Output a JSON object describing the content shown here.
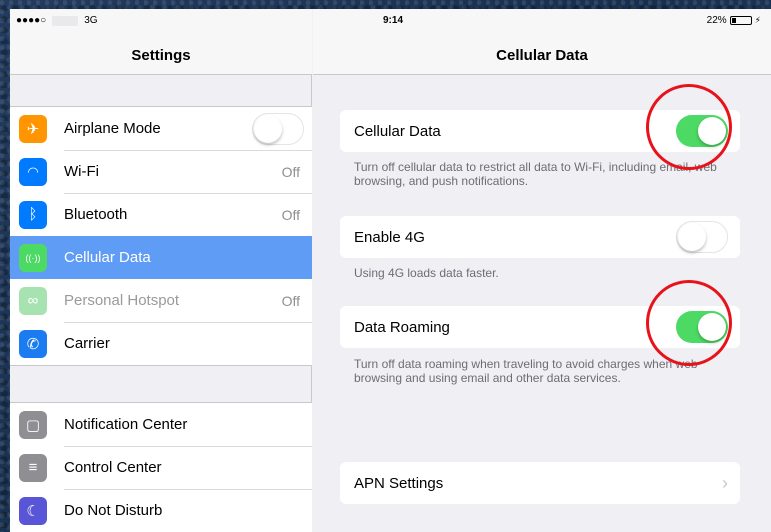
{
  "status": {
    "signal": "●●●●○",
    "network": "3G",
    "time": "9:14",
    "battery": "22%"
  },
  "left": {
    "title": "Settings",
    "group1": [
      {
        "label": "Airplane Mode",
        "icon": "airplane-icon",
        "icon_glyph": "✈",
        "color": "#ff9500",
        "control": "toggle-off"
      },
      {
        "label": "Wi-Fi",
        "icon": "wifi-icon",
        "icon_glyph": "◠",
        "color": "#007aff",
        "value": "Off"
      },
      {
        "label": "Bluetooth",
        "icon": "bluetooth-icon",
        "icon_glyph": "ᛒ",
        "color": "#007aff",
        "value": "Off"
      },
      {
        "label": "Cellular Data",
        "icon": "cellular-icon",
        "icon_glyph": "((·))",
        "color": "#4cd964",
        "selected": true
      },
      {
        "label": "Personal Hotspot",
        "icon": "hotspot-icon",
        "icon_glyph": "∞",
        "color": "#a6e3b0",
        "value": "Off",
        "dimmed": true
      },
      {
        "label": "Carrier",
        "icon": "phone-icon",
        "icon_glyph": "✆",
        "color": "#1a7cf0"
      }
    ],
    "group2": [
      {
        "label": "Notification Center",
        "icon": "notification-icon",
        "icon_glyph": "▢",
        "color": "#8e8e93"
      },
      {
        "label": "Control Center",
        "icon": "control-center-icon",
        "icon_glyph": "≡",
        "color": "#8e8e93"
      },
      {
        "label": "Do Not Disturb",
        "icon": "moon-icon",
        "icon_glyph": "☾",
        "color": "#5856d6"
      }
    ]
  },
  "right": {
    "title": "Cellular Data",
    "cellular_data": {
      "label": "Cellular Data",
      "on": true,
      "note": "Turn off cellular data to restrict all data to Wi-Fi, including email, web browsing, and push notifications."
    },
    "enable_4g": {
      "label": "Enable 4G",
      "on": false,
      "note": "Using 4G loads data faster."
    },
    "data_roaming": {
      "label": "Data Roaming",
      "on": true,
      "note": "Turn off data roaming when traveling to avoid charges when web browsing and using email and other data services."
    },
    "apn": {
      "label": "APN Settings",
      "chevron": "›"
    }
  },
  "colors": {
    "accent_selected": "#5f9cf5",
    "toggle_on": "#4cd964",
    "annotation": "#e8121a"
  }
}
